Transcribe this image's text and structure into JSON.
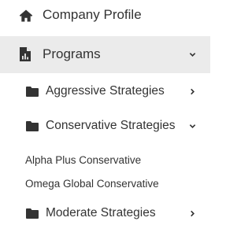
{
  "nav": {
    "company_profile": {
      "label": "Company Profile",
      "icon": "home-icon"
    },
    "programs": {
      "label": "Programs",
      "icon": "report-file-icon",
      "expanded": true,
      "children": [
        {
          "label": "Aggressive Strategies",
          "icon": "folder-icon",
          "expanded": false
        },
        {
          "label": "Conservative Strategies",
          "icon": "folder-icon",
          "expanded": true,
          "children": [
            {
              "label": "Alpha Plus Conservative"
            },
            {
              "label": "Omega Global Conservative"
            }
          ]
        },
        {
          "label": "Moderate Strategies",
          "icon": "folder-icon",
          "expanded": false
        }
      ]
    }
  },
  "colors": {
    "text": "#333333",
    "active_background": "#ebebeb",
    "background": "#ffffff"
  }
}
